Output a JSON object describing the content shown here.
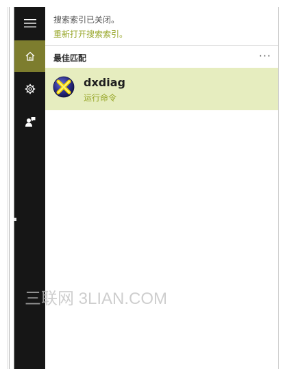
{
  "search_panel": {
    "notice_text": "搜索索引已关闭。",
    "reopen_link": "重新打开搜索索引。",
    "section_title": "最佳匹配",
    "more_label": "···",
    "best_match": {
      "name": "dxdiag",
      "subtitle": "运行命令",
      "icon": "dxdiag-icon"
    }
  },
  "sidebar": {
    "items": [
      {
        "icon": "hamburger-menu-icon"
      },
      {
        "icon": "home-icon",
        "active": true
      },
      {
        "icon": "gear-icon"
      },
      {
        "icon": "feedback-icon"
      }
    ]
  },
  "watermark": "三联网 3LIAN.COM",
  "colors": {
    "accent": "#97a628",
    "active_rail": "#7d7d2e",
    "highlight_row": "#e6edbf",
    "rail_bg": "#161616"
  }
}
